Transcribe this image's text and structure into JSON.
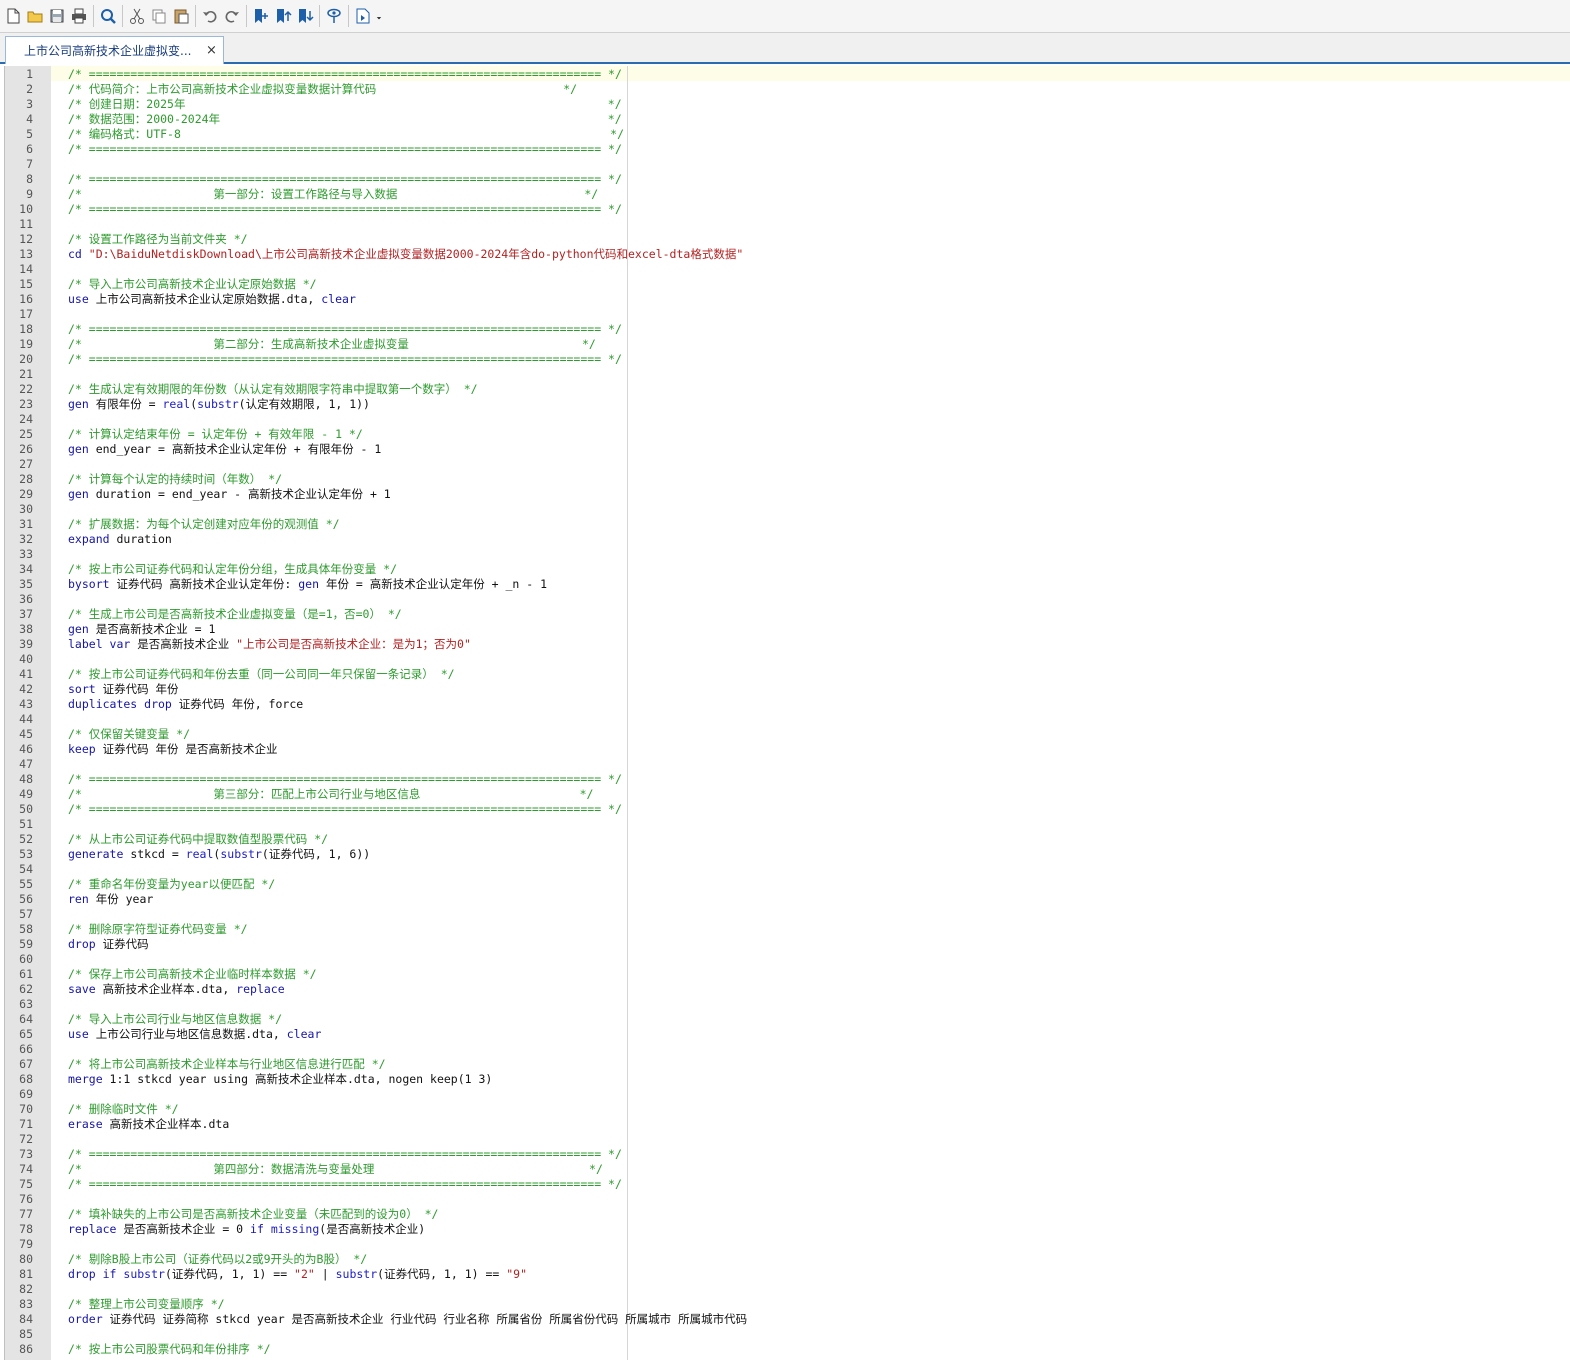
{
  "tab": {
    "label": "上市公司高新技术企业虚拟变...",
    "close": "×"
  },
  "toolbar": [
    "new-file-icon",
    "open-folder-icon",
    "save-icon",
    "print-icon",
    "|",
    "search-icon",
    "|",
    "cut-icon",
    "copy-icon",
    "paste-icon",
    "|",
    "undo-icon",
    "redo-icon",
    "|",
    "bookmark-toggle-icon",
    "bookmark-prev-icon",
    "bookmark-next-icon",
    "|",
    "show-hide-icon",
    "|",
    "do-file-icon",
    "dropdown-arrow-icon"
  ],
  "colors": {
    "comment": "#2e9b2e",
    "keyword": "#1515a8",
    "string": "#b22222",
    "text": "#111111"
  },
  "lines": [
    [
      [
        "c",
        "/* ========================================================================== */"
      ]
    ],
    [
      [
        "c",
        "/* 代码简介：上市公司高新技术企业虚拟变量数据计算代码                           */"
      ]
    ],
    [
      [
        "c",
        "/* 创建日期：2025年                                                             */"
      ]
    ],
    [
      [
        "c",
        "/* 数据范围：2000-2024年                                                        */"
      ]
    ],
    [
      [
        "c",
        "/* 编码格式：UTF-8                                                              */"
      ]
    ],
    [
      [
        "c",
        "/* ========================================================================== */"
      ]
    ],
    [],
    [
      [
        "c",
        "/* ========================================================================== */"
      ]
    ],
    [
      [
        "c",
        "/*                   第一部分：设置工作路径与导入数据                           */"
      ]
    ],
    [
      [
        "c",
        "/* ========================================================================== */"
      ]
    ],
    [],
    [
      [
        "c",
        "/* 设置工作路径为当前文件夹 */"
      ]
    ],
    [
      [
        "k",
        "cd"
      ],
      [
        "t",
        " "
      ],
      [
        "s",
        "\"D:\\BaiduNetdiskDownload\\上市公司高新技术企业虚拟变量数据2000-2024年含do-python代码和excel-dta格式数据\""
      ]
    ],
    [],
    [
      [
        "c",
        "/* 导入上市公司高新技术企业认定原始数据 */"
      ]
    ],
    [
      [
        "k",
        "use"
      ],
      [
        "t",
        " 上市公司高新技术企业认定原始数据.dta, "
      ],
      [
        "k",
        "clear"
      ]
    ],
    [],
    [
      [
        "c",
        "/* ========================================================================== */"
      ]
    ],
    [
      [
        "c",
        "/*                   第二部分：生成高新技术企业虚拟变量                         */"
      ]
    ],
    [
      [
        "c",
        "/* ========================================================================== */"
      ]
    ],
    [],
    [
      [
        "c",
        "/* 生成认定有效期限的年份数（从认定有效期限字符串中提取第一个数字） */"
      ]
    ],
    [
      [
        "k",
        "gen"
      ],
      [
        "t",
        " 有限年份 = "
      ],
      [
        "f",
        "real"
      ],
      [
        "t",
        "("
      ],
      [
        "f",
        "substr"
      ],
      [
        "t",
        "(认定有效期限, 1, 1))"
      ]
    ],
    [],
    [
      [
        "c",
        "/* 计算认定结束年份 = 认定年份 + 有效年限 - 1 */"
      ]
    ],
    [
      [
        "k",
        "gen"
      ],
      [
        "t",
        " end_year = 高新技术企业认定年份 + 有限年份 - 1"
      ]
    ],
    [],
    [
      [
        "c",
        "/* 计算每个认定的持续时间（年数） */"
      ]
    ],
    [
      [
        "k",
        "gen"
      ],
      [
        "t",
        " duration = end_year - 高新技术企业认定年份 + 1"
      ]
    ],
    [],
    [
      [
        "c",
        "/* 扩展数据：为每个认定创建对应年份的观测值 */"
      ]
    ],
    [
      [
        "k",
        "expand"
      ],
      [
        "t",
        " duration"
      ]
    ],
    [],
    [
      [
        "c",
        "/* 按上市公司证券代码和认定年份分组，生成具体年份变量 */"
      ]
    ],
    [
      [
        "k",
        "bysort"
      ],
      [
        "t",
        " 证券代码 高新技术企业认定年份: "
      ],
      [
        "k",
        "gen"
      ],
      [
        "t",
        " 年份 = 高新技术企业认定年份 + _n - 1"
      ]
    ],
    [],
    [
      [
        "c",
        "/* 生成上市公司是否高新技术企业虚拟变量（是=1，否=0） */"
      ]
    ],
    [
      [
        "k",
        "gen"
      ],
      [
        "t",
        " 是否高新技术企业 = 1"
      ]
    ],
    [
      [
        "k",
        "label var"
      ],
      [
        "t",
        " 是否高新技术企业 "
      ],
      [
        "s",
        "\"上市公司是否高新技术企业：是为1；否为0\""
      ]
    ],
    [],
    [
      [
        "c",
        "/* 按上市公司证券代码和年份去重（同一公司同一年只保留一条记录） */"
      ]
    ],
    [
      [
        "k",
        "sort"
      ],
      [
        "t",
        " 证券代码 年份"
      ]
    ],
    [
      [
        "k",
        "duplicates drop"
      ],
      [
        "t",
        " 证券代码 年份, force"
      ]
    ],
    [],
    [
      [
        "c",
        "/* 仅保留关键变量 */"
      ]
    ],
    [
      [
        "k",
        "keep"
      ],
      [
        "t",
        " 证券代码 年份 是否高新技术企业"
      ]
    ],
    [],
    [
      [
        "c",
        "/* ========================================================================== */"
      ]
    ],
    [
      [
        "c",
        "/*                   第三部分：匹配上市公司行业与地区信息                       */"
      ]
    ],
    [
      [
        "c",
        "/* ========================================================================== */"
      ]
    ],
    [],
    [
      [
        "c",
        "/* 从上市公司证券代码中提取数值型股票代码 */"
      ]
    ],
    [
      [
        "k",
        "generate"
      ],
      [
        "t",
        " stkcd = "
      ],
      [
        "f",
        "real"
      ],
      [
        "t",
        "("
      ],
      [
        "f",
        "substr"
      ],
      [
        "t",
        "(证券代码, 1, 6))"
      ]
    ],
    [],
    [
      [
        "c",
        "/* 重命名年份变量为year以便匹配 */"
      ]
    ],
    [
      [
        "k",
        "ren"
      ],
      [
        "t",
        " 年份 year"
      ]
    ],
    [],
    [
      [
        "c",
        "/* 删除原字符型证券代码变量 */"
      ]
    ],
    [
      [
        "k",
        "drop"
      ],
      [
        "t",
        " 证券代码"
      ]
    ],
    [],
    [
      [
        "c",
        "/* 保存上市公司高新技术企业临时样本数据 */"
      ]
    ],
    [
      [
        "k",
        "save"
      ],
      [
        "t",
        " 高新技术企业样本.dta, "
      ],
      [
        "k",
        "replace"
      ]
    ],
    [],
    [
      [
        "c",
        "/* 导入上市公司行业与地区信息数据 */"
      ]
    ],
    [
      [
        "k",
        "use"
      ],
      [
        "t",
        " 上市公司行业与地区信息数据.dta, "
      ],
      [
        "k",
        "clear"
      ]
    ],
    [],
    [
      [
        "c",
        "/* 将上市公司高新技术企业样本与行业地区信息进行匹配 */"
      ]
    ],
    [
      [
        "k",
        "merge"
      ],
      [
        "t",
        " 1:1 stkcd year using 高新技术企业样本.dta, nogen keep(1 3)"
      ]
    ],
    [],
    [
      [
        "c",
        "/* 删除临时文件 */"
      ]
    ],
    [
      [
        "k",
        "erase"
      ],
      [
        "t",
        " 高新技术企业样本.dta"
      ]
    ],
    [],
    [
      [
        "c",
        "/* ========================================================================== */"
      ]
    ],
    [
      [
        "c",
        "/*                   第四部分：数据清洗与变量处理                               */"
      ]
    ],
    [
      [
        "c",
        "/* ========================================================================== */"
      ]
    ],
    [],
    [
      [
        "c",
        "/* 填补缺失的上市公司是否高新技术企业变量（未匹配到的设为0） */"
      ]
    ],
    [
      [
        "k",
        "replace"
      ],
      [
        "t",
        " 是否高新技术企业 = 0 "
      ],
      [
        "k",
        "if"
      ],
      [
        "t",
        " "
      ],
      [
        "f",
        "missing"
      ],
      [
        "t",
        "(是否高新技术企业)"
      ]
    ],
    [],
    [
      [
        "c",
        "/* 剔除B股上市公司（证券代码以2或9开头的为B股） */"
      ]
    ],
    [
      [
        "k",
        "drop if"
      ],
      [
        "t",
        " "
      ],
      [
        "f",
        "substr"
      ],
      [
        "t",
        "(证券代码, 1, 1) == "
      ],
      [
        "s",
        "\"2\""
      ],
      [
        "t",
        " | "
      ],
      [
        "f",
        "substr"
      ],
      [
        "t",
        "(证券代码, 1, 1) == "
      ],
      [
        "s",
        "\"9\""
      ]
    ],
    [],
    [
      [
        "c",
        "/* 整理上市公司变量顺序 */"
      ]
    ],
    [
      [
        "k",
        "order"
      ],
      [
        "t",
        " 证券代码 证券简称 stkcd year 是否高新技术企业 行业代码 行业名称 所属省份 所属省份代码 所属城市 所属城市代码"
      ]
    ],
    [],
    [
      [
        "c",
        "/* 按上市公司股票代码和年份排序 */"
      ]
    ]
  ]
}
